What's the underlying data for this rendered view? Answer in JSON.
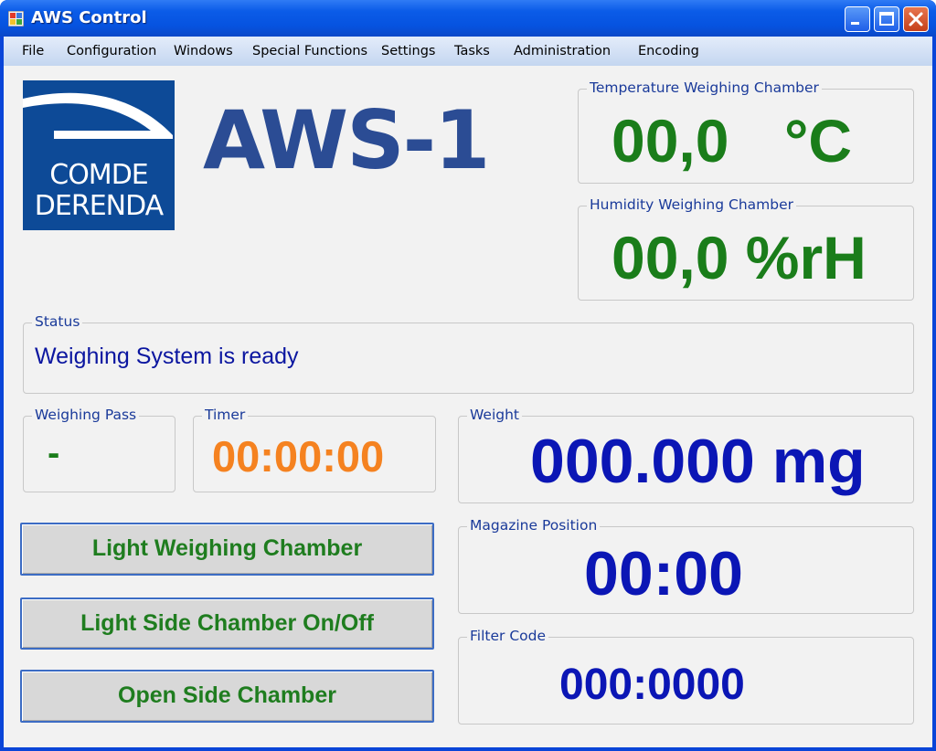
{
  "window": {
    "title": "AWS Control"
  },
  "menu": {
    "items": [
      "File",
      "Configuration",
      "Windows",
      "Special Functions",
      "Settings",
      "Tasks",
      "Administration",
      "Encoding"
    ]
  },
  "logo": {
    "line1": "COMDE",
    "line2": "DERENDA"
  },
  "device": {
    "name": "AWS-1"
  },
  "temperature": {
    "label": "Temperature Weighing Chamber",
    "value": "00,0",
    "unit": "°C"
  },
  "humidity": {
    "label": "Humidity Weighing Chamber",
    "value": "00,0 %rH"
  },
  "status": {
    "label": "Status",
    "text": "Weighing System is ready"
  },
  "weighing_pass": {
    "label": "Weighing Pass",
    "value": "-"
  },
  "timer": {
    "label": "Timer",
    "value": "00:00:00"
  },
  "weight": {
    "label": "Weight",
    "value": "000.000 mg"
  },
  "magazine": {
    "label": "Magazine Position",
    "value": "00:00"
  },
  "filter": {
    "label": "Filter Code",
    "value": "000:0000"
  },
  "buttons": {
    "light_weighing": "Light Weighing Chamber",
    "light_side": "Light Side Chamber On/Off",
    "open_side": "Open Side Chamber"
  },
  "colors": {
    "green_value": "#1a7d1a",
    "blue_value": "#0b16b5",
    "orange_value": "#f58220",
    "title_blue": "#2b4c94",
    "logo_blue": "#0d4a97"
  },
  "icons": {
    "app": "app-grid-icon",
    "minimize": "minimize-icon",
    "maximize": "maximize-icon",
    "close": "close-icon"
  }
}
